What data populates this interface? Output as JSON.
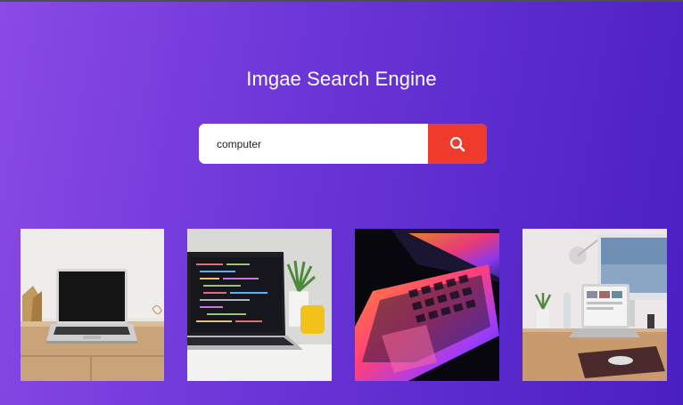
{
  "app": {
    "title": "Imgae Search Engine"
  },
  "search": {
    "value": "computer"
  },
  "results": [
    {
      "description": "Laptop on wooden desk",
      "icon": "photo"
    },
    {
      "description": "Laptop showing code",
      "icon": "photo"
    },
    {
      "description": "Laptop keyboard with colorful light",
      "icon": "photo"
    },
    {
      "description": "Desk setup with laptop and monitor",
      "icon": "photo"
    }
  ],
  "colors": {
    "bg_start": "#8a4ae6",
    "bg_end": "#4a1fc2",
    "search_button": "#f03a2c"
  }
}
